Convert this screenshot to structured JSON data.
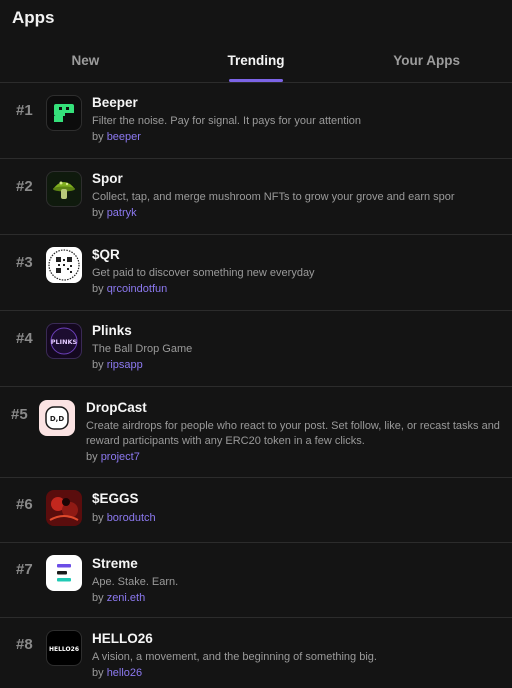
{
  "header": {
    "title": "Apps"
  },
  "tabs": [
    {
      "label": "New"
    },
    {
      "label": "Trending"
    },
    {
      "label": "Your Apps"
    }
  ],
  "by_prefix": "by",
  "apps": [
    {
      "rank": "#1",
      "name": "Beeper",
      "desc": "Filter the noise. Pay for signal. It pays for your attention",
      "author": "beeper",
      "icon": "beeper-icon"
    },
    {
      "rank": "#2",
      "name": "Spor",
      "desc": "Collect, tap, and merge mushroom NFTs to grow your grove and earn spor",
      "author": "patryk",
      "icon": "mushroom-icon"
    },
    {
      "rank": "#3",
      "name": "$QR",
      "desc": "Get paid to discover something new everyday",
      "author": "qrcoindotfun",
      "icon": "qr-code-icon"
    },
    {
      "rank": "#4",
      "name": "Plinks",
      "desc": "The Ball Drop Game",
      "author": "ripsapp",
      "icon": "plinks-logo-icon",
      "logo_text": "PLINKS"
    },
    {
      "rank": "#5",
      "name": "DropCast",
      "desc": "Create airdrops for people who react to your post. Set follow, like, or recast tasks and reward participants with any ERC20 token in a few clicks.",
      "author": "project7",
      "icon": "dropcast-face-icon",
      "logo_text": "D,D"
    },
    {
      "rank": "#6",
      "name": "$EGGS",
      "desc": "",
      "author": "borodutch",
      "icon": "eggs-art-icon"
    },
    {
      "rank": "#7",
      "name": "Streme",
      "desc": "Ape. Stake. Earn.",
      "author": "zeni.eth",
      "icon": "streme-logo-icon"
    },
    {
      "rank": "#8",
      "name": "HELLO26",
      "desc": "A vision, a movement, and the beginning of something big.",
      "author": "hello26",
      "icon": "hello26-logo-icon",
      "logo_text": "HELLO26"
    }
  ],
  "colors": {
    "accent": "#7c64e6",
    "link": "#8c79f0",
    "background": "#141414"
  }
}
